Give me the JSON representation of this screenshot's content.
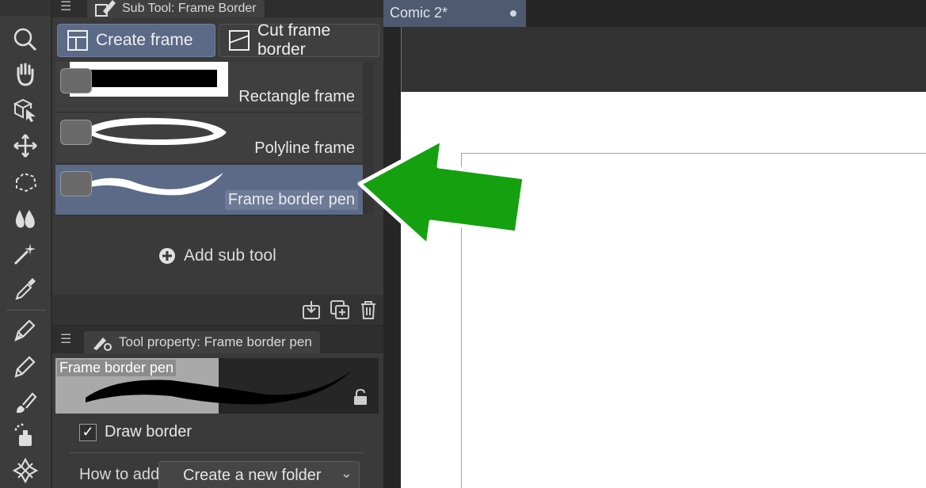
{
  "sub_tool_panel": {
    "title": "Sub Tool: Frame Border",
    "groups": [
      {
        "label": "Create frame",
        "active": true
      },
      {
        "label": "Cut frame border",
        "active": false
      }
    ],
    "items": [
      {
        "label": "Rectangle frame",
        "selected": false
      },
      {
        "label": "Polyline frame",
        "selected": false
      },
      {
        "label": "Frame border pen",
        "selected": true
      }
    ],
    "add_label": "Add sub tool"
  },
  "tool_property": {
    "title": "Tool property: Frame border pen",
    "preview_name": "Frame border pen",
    "draw_border_label": "Draw border",
    "draw_border_checked": true,
    "how_to_add_label": "How to add",
    "how_to_add_value": "Create a new folder"
  },
  "document": {
    "tab_title": "Comic 2*"
  },
  "icons": [
    "zoom-icon",
    "hand-icon",
    "object-icon",
    "move-icon",
    "lasso-icon",
    "fill-icon",
    "magic-wand-icon",
    "eyedropper-icon",
    "pen-icon",
    "pencil-icon",
    "brush-icon",
    "airbrush-icon",
    "decoration-icon"
  ],
  "colors": {
    "highlight_arrow": "#15a010",
    "selected_item": "#5b6a86"
  }
}
